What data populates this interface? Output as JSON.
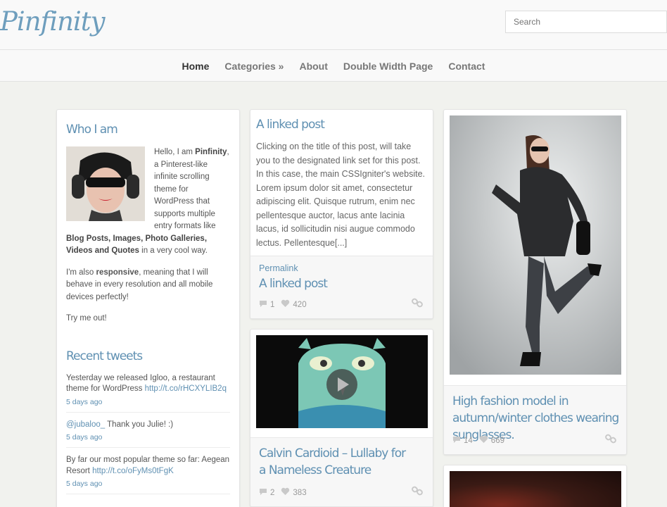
{
  "site": {
    "logo": "Pinfinity"
  },
  "search": {
    "placeholder": "Search"
  },
  "nav": {
    "items": [
      "Home",
      "Categories »",
      "About",
      "Double Width Page",
      "Contact"
    ]
  },
  "sidebar": {
    "about_title": "Who I am",
    "about_intro_1": "Hello, I am ",
    "about_intro_bold": "Pinfinity",
    "about_intro_2": ", a Pinterest-like infinite scrolling theme for WordPress that supports multiple entry formats like ",
    "about_formats": "Blog Posts, Images, Photo Galleries, Videos and Quotes",
    "about_intro_3": " in a very cool way.",
    "about_resp_1": "I'm also ",
    "about_resp_bold": "responsive",
    "about_resp_2": ", meaning that I will behave in every resolution and all mobile devices perfectly!",
    "about_try": "Try me out!",
    "tweets_title": "Recent tweets",
    "tweets": [
      {
        "text": "Yesterday we released Igloo, a restaurant theme for WordPress ",
        "link": "http://t.co/rHCXYLIB2q",
        "time": "5 days ago"
      },
      {
        "text": "",
        "link": "@jubaloo_",
        "text2": " Thank you Julie! :)",
        "time": "5 days ago"
      },
      {
        "text": "By far our most popular theme so far: Aegean Resort ",
        "link": "http://t.co/oFyMs0tFgK",
        "time": "5 days ago"
      }
    ]
  },
  "posts": {
    "linked": {
      "title": "A linked post",
      "body": "Clicking on the title of this post, will take you to the designated link set for this post. In this case, the main CSSIgniter's website. Lorem ipsum dolor sit amet, consectetur adipiscing elit. Quisque rutrum, enim nec pellentesque auctor, lacus ante lacinia lacus, id sollicitudin nisi augue commodo lectus. Pellentesque[...]",
      "permalink": "Permalink",
      "footer_title": "A linked post",
      "comments": "1",
      "likes": "420"
    },
    "video": {
      "title": "Calvin Cardioid – Lullaby for a Nameless Creature",
      "comments": "2",
      "likes": "383"
    },
    "fashion": {
      "title": "High fashion model in autumn/winter clothes wearing sunglasses.",
      "comments": "14",
      "likes": "669"
    }
  },
  "colors": {
    "accent": "#5f90b2",
    "background": "#f1f2ee"
  }
}
